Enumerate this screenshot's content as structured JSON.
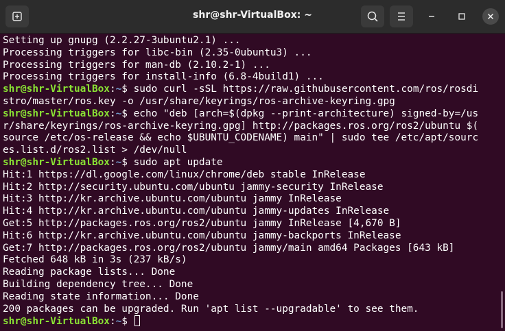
{
  "window": {
    "title": "shr@shr-VirtualBox: ~"
  },
  "titlebar": {
    "new_tab_icon": "new-tab-icon",
    "search_icon": "search-icon",
    "menu_icon": "hamburger-menu-icon",
    "minimize_icon": "minimize-icon",
    "maximize_icon": "maximize-icon",
    "close_icon": "close-icon"
  },
  "colors": {
    "terminal_bg": "#300a24",
    "titlebar_bg": "#2c2c2c",
    "prompt_user": "#8ae234",
    "prompt_path": "#729fcf",
    "text": "#ffffff"
  },
  "terminal": {
    "lines": [
      {
        "text": "Setting up gnupg (2.2.27-3ubuntu2.1) ..."
      },
      {
        "text": "Processing triggers for libc-bin (2.35-0ubuntu3) ..."
      },
      {
        "text": "Processing triggers for man-db (2.10.2-1) ..."
      },
      {
        "text": "Processing triggers for install-info (6.8-4build1) ..."
      },
      {
        "prompt_user": "shr@shr-VirtualBox",
        "prompt_sep": ":",
        "prompt_path": "~",
        "prompt_end": "$ ",
        "text": "sudo curl -sSL https://raw.githubusercontent.com/ros/rosdi"
      },
      {
        "text": "stro/master/ros.key -o /usr/share/keyrings/ros-archive-keyring.gpg"
      },
      {
        "prompt_user": "shr@shr-VirtualBox",
        "prompt_sep": ":",
        "prompt_path": "~",
        "prompt_end": "$ ",
        "text": "echo \"deb [arch=$(dpkg --print-architecture) signed-by=/us"
      },
      {
        "text": "r/share/keyrings/ros-archive-keyring.gpg] http://packages.ros.org/ros2/ubuntu $("
      },
      {
        "text": "source /etc/os-release && echo $UBUNTU_CODENAME) main\" | sudo tee /etc/apt/sourc"
      },
      {
        "text": "es.list.d/ros2.list > /dev/null"
      },
      {
        "prompt_user": "shr@shr-VirtualBox",
        "prompt_sep": ":",
        "prompt_path": "~",
        "prompt_end": "$ ",
        "text": "sudo apt update"
      },
      {
        "text": "Hit:1 https://dl.google.com/linux/chrome/deb stable InRelease"
      },
      {
        "text": "Hit:2 http://security.ubuntu.com/ubuntu jammy-security InRelease"
      },
      {
        "text": "Hit:3 http://kr.archive.ubuntu.com/ubuntu jammy InRelease"
      },
      {
        "text": "Hit:4 http://kr.archive.ubuntu.com/ubuntu jammy-updates InRelease"
      },
      {
        "text": "Get:5 http://packages.ros.org/ros2/ubuntu jammy InRelease [4,670 B]"
      },
      {
        "text": "Hit:6 http://kr.archive.ubuntu.com/ubuntu jammy-backports InRelease"
      },
      {
        "text": "Get:7 http://packages.ros.org/ros2/ubuntu jammy/main amd64 Packages [643 kB]"
      },
      {
        "text": "Fetched 648 kB in 3s (237 kB/s)"
      },
      {
        "text": "Reading package lists... Done"
      },
      {
        "text": "Building dependency tree... Done"
      },
      {
        "text": "Reading state information... Done"
      },
      {
        "text": "200 packages can be upgraded. Run 'apt list --upgradable' to see them."
      },
      {
        "prompt_user": "shr@shr-VirtualBox",
        "prompt_sep": ":",
        "prompt_path": "~",
        "prompt_end": "$ ",
        "text": "",
        "cursor": true
      }
    ]
  }
}
